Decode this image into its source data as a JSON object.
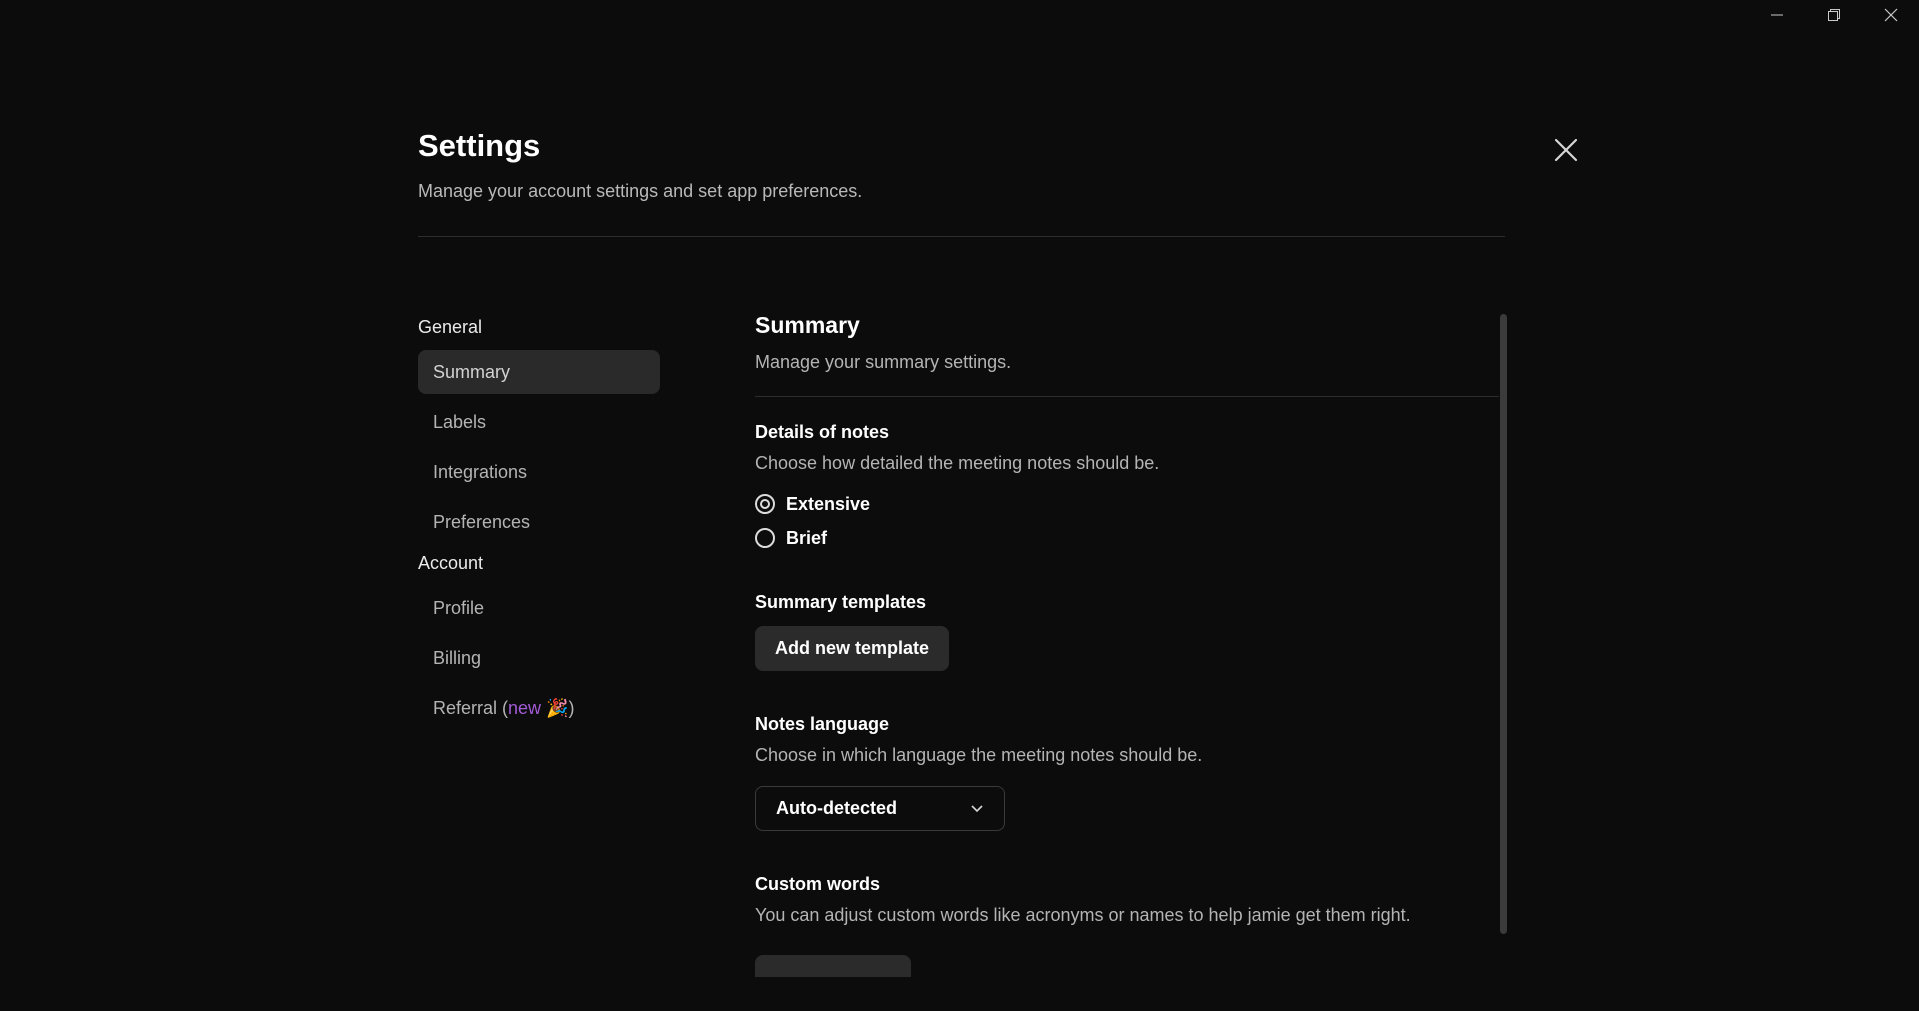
{
  "window": {
    "minimize_icon": "minimize-icon",
    "maximize_icon": "restore-icon",
    "close_icon": "close-icon"
  },
  "header": {
    "title": "Settings",
    "subtitle": "Manage your account settings and set app preferences."
  },
  "nav": {
    "general_label": "General",
    "account_label": "Account",
    "general_items": [
      {
        "label": "Summary",
        "active": true
      },
      {
        "label": "Labels"
      },
      {
        "label": "Integrations"
      },
      {
        "label": "Preferences"
      }
    ],
    "account_items": [
      {
        "label": "Profile"
      },
      {
        "label": "Billing"
      }
    ],
    "referral": {
      "label": "Referral (",
      "tag": "new 🎉",
      "suffix": ")"
    }
  },
  "content": {
    "title": "Summary",
    "subtitle": "Manage your summary settings.",
    "details": {
      "title": "Details of notes",
      "desc": "Choose how detailed the meeting notes should be.",
      "options": [
        "Extensive",
        "Brief"
      ],
      "selected": "Extensive"
    },
    "templates": {
      "title": "Summary templates",
      "button": "Add new template"
    },
    "language": {
      "title": "Notes language",
      "desc": "Choose in which language the meeting notes should be.",
      "selected": "Auto-detected"
    },
    "custom_words": {
      "title": "Custom words",
      "desc": "You can adjust custom words like acronyms or names to help jamie get them right."
    }
  }
}
